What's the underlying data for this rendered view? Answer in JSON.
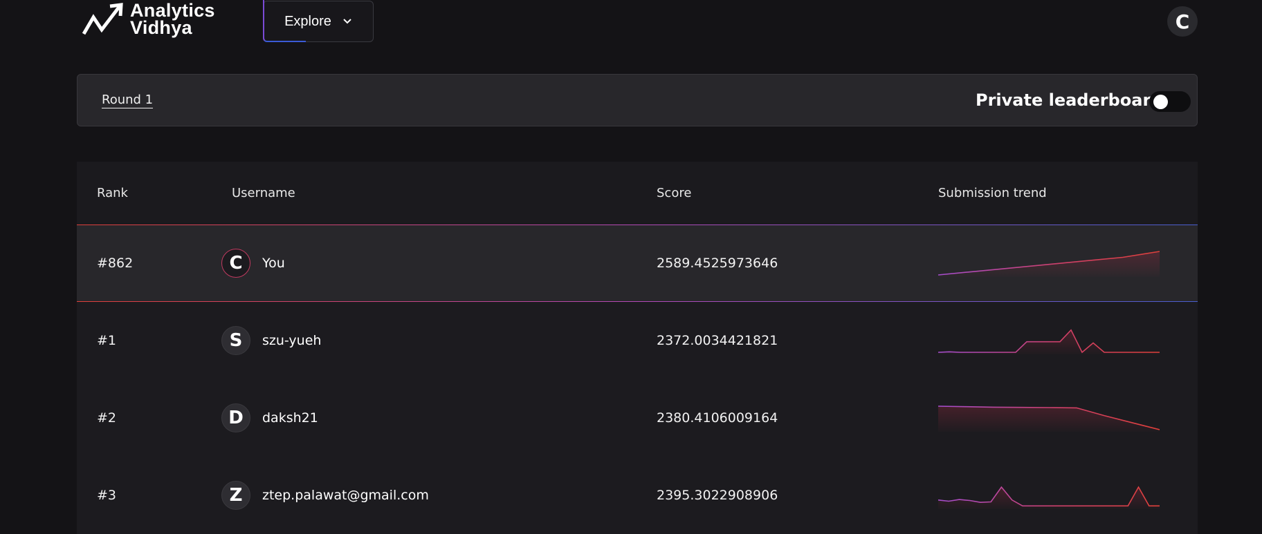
{
  "header": {
    "logo": {
      "line1": "Analytics",
      "line2": "Vidhya",
      "icon": "trend-arrow-logo"
    },
    "explore_label": "Explore",
    "user_initial": "C"
  },
  "round_bar": {
    "round_tab": "Round 1",
    "private_label": "Private leaderboard",
    "private_enabled": false
  },
  "table": {
    "columns": {
      "rank": "Rank",
      "username": "Username",
      "score": "Score",
      "trend": "Submission trend"
    },
    "rows": [
      {
        "rank": "#862",
        "initial": "C",
        "username": "You",
        "score": "2589.4525973646",
        "is_me": true,
        "trend": [
          0,
          0.15,
          0.3,
          0.45,
          0.6,
          0.75,
          1.0
        ]
      },
      {
        "rank": "#1",
        "initial": "S",
        "username": "szu-yueh",
        "score": "2372.0034421821",
        "is_me": false,
        "trend": [
          0.0,
          0.02,
          0.0,
          0.0,
          0.0,
          0.0,
          0.0,
          0.0,
          0.45,
          0.45,
          0.45,
          0.45,
          0.95,
          0.0,
          0.4,
          0.0,
          0.0,
          0.0,
          0.0,
          0.0,
          0.0
        ]
      },
      {
        "rank": "#2",
        "initial": "D",
        "username": "daksh21",
        "score": "2380.4106009164",
        "is_me": false,
        "trend": [
          1.0,
          0.98,
          0.96,
          0.95,
          0.94,
          0.93,
          0.6,
          0.3,
          0.0
        ]
      },
      {
        "rank": "#3",
        "initial": "Z",
        "username": "ztep.palawat@gmail.com",
        "score": "2395.3022908906",
        "is_me": false,
        "trend": [
          0.3,
          0.25,
          0.32,
          0.28,
          0.2,
          0.22,
          0.85,
          0.3,
          0.05,
          0.05,
          0.05,
          0.05,
          0.05,
          0.05,
          0.05,
          0.05,
          0.05,
          0.05,
          0.05,
          0.85,
          0.05,
          0.05
        ]
      }
    ]
  },
  "colors": {
    "accent_red": "#e0403a",
    "accent_purple": "#b44ab8",
    "accent_blue": "#4a5fd0",
    "background": "#141316"
  }
}
